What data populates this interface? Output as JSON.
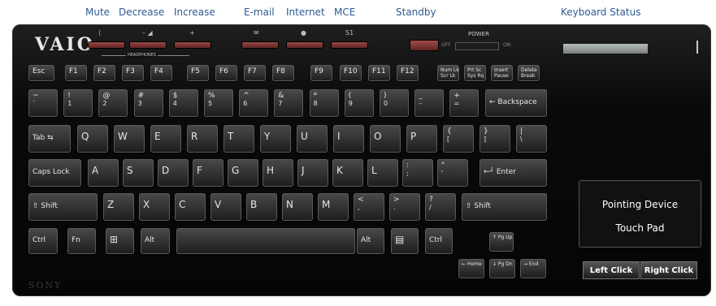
{
  "callouts": {
    "mute": "Mute",
    "decrease": "Decrease",
    "increase": "Increase",
    "email": "E-mail",
    "internet": "Internet",
    "mce": "MCE",
    "standby": "Standby",
    "keyboard_status": "Keyboard Status"
  },
  "keyboard": {
    "logo": "VAIO",
    "brand": "SONY",
    "headphones_label": "HEADPHONES",
    "power_label": "POWER",
    "off_label": "OFF",
    "on_label": "ON",
    "media_icons": {
      "mute": "⟨",
      "decrease": "– ◢",
      "increase": "+",
      "email": "✉",
      "internet": "●",
      "mce": "S1"
    }
  },
  "rows": {
    "fn": [
      "Esc",
      "F1",
      "F2",
      "F3",
      "F4",
      "F5",
      "F6",
      "F7",
      "F8",
      "F9",
      "F10",
      "F11",
      "F12"
    ],
    "fn_special": [
      "Num Lk Scr Lk",
      "Prt Sc Sys Rq",
      "Insert Pause",
      "Delete Break"
    ],
    "number": [
      {
        "top": "~",
        "bottom": "`"
      },
      {
        "top": "!",
        "bottom": "1"
      },
      {
        "top": "@",
        "bottom": "2"
      },
      {
        "top": "#",
        "bottom": "3"
      },
      {
        "top": "$",
        "bottom": "4"
      },
      {
        "top": "%",
        "bottom": "5"
      },
      {
        "top": "^",
        "bottom": "6"
      },
      {
        "top": "&",
        "bottom": "7"
      },
      {
        "top": "*",
        "bottom": "8"
      },
      {
        "top": "(",
        "bottom": "9"
      },
      {
        "top": ")",
        "bottom": "0"
      },
      {
        "top": "_",
        "bottom": "–"
      },
      {
        "top": "+",
        "bottom": "="
      }
    ],
    "backspace": "← Backspace",
    "tab": "Tab ⇆",
    "q_row": [
      "Q",
      "W",
      "E",
      "R",
      "T",
      "Y",
      "U",
      "I",
      "O",
      "P"
    ],
    "q_row_sym": [
      {
        "top": "{",
        "bottom": "["
      },
      {
        "top": "}",
        "bottom": "]"
      },
      {
        "top": "|",
        "bottom": "\\"
      }
    ],
    "caps": "Caps Lock",
    "a_row": [
      "A",
      "S",
      "D",
      "F",
      "G",
      "H",
      "J",
      "K",
      "L"
    ],
    "a_row_sym": [
      {
        "top": ":",
        "bottom": ";"
      },
      {
        "top": "\"",
        "bottom": "'"
      }
    ],
    "enter": "←┘ Enter",
    "shift_left": "⇧ Shift",
    "z_row": [
      "Z",
      "X",
      "C",
      "V",
      "B",
      "N",
      "M"
    ],
    "z_row_sym": [
      {
        "top": "<",
        "bottom": ","
      },
      {
        "top": ">",
        "bottom": "."
      },
      {
        "top": "?",
        "bottom": "/"
      }
    ],
    "shift_right": "⇧ Shift",
    "bottom": {
      "ctrl": "Ctrl",
      "fn": "Fn",
      "win": "⊞",
      "alt": "Alt",
      "alt_r": "Alt",
      "menu": "▤",
      "ctrl_r": "Ctrl"
    },
    "arrows": {
      "up": "↑ Pg Up",
      "left": "← Home",
      "down": "↓ Pg Dn",
      "right": "→ End"
    }
  },
  "touchpad": {
    "line1": "Pointing Device",
    "line2": "Touch Pad",
    "left_click": "Left Click",
    "right_click": "Right Click"
  }
}
